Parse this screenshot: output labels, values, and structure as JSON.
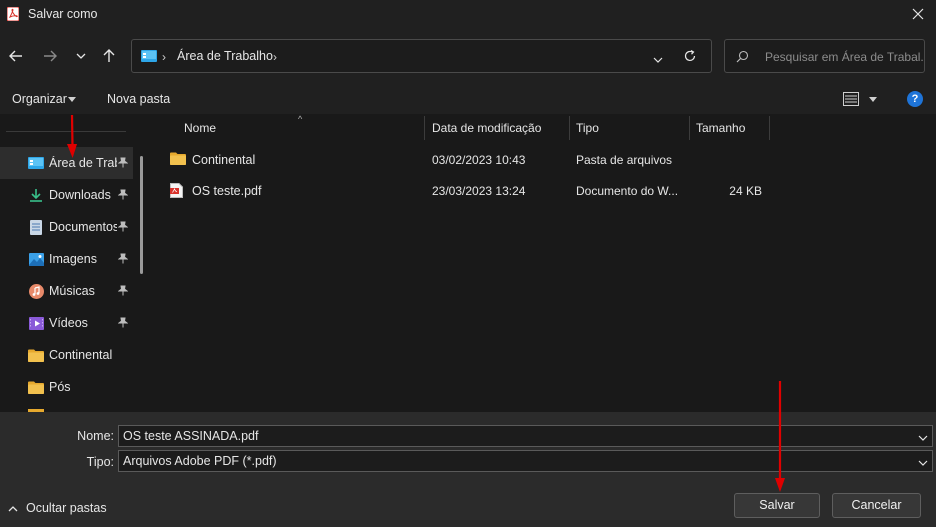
{
  "window": {
    "title": "Salvar como"
  },
  "address_bar": {
    "location": "Área de Trabalho"
  },
  "search": {
    "placeholder": "Pesquisar em Área de Trabal..."
  },
  "command_bar": {
    "organize_label": "Organizar",
    "new_folder_label": "Nova pasta"
  },
  "sidebar": {
    "items": [
      {
        "label": "Área de Trabalho",
        "icon": "desktop-icon",
        "pinned": true,
        "selected": true
      },
      {
        "label": "Downloads",
        "icon": "download-icon",
        "pinned": true
      },
      {
        "label": "Documentos",
        "icon": "document-icon",
        "pinned": true
      },
      {
        "label": "Imagens",
        "icon": "image-icon",
        "pinned": true
      },
      {
        "label": "Músicas",
        "icon": "music-icon",
        "pinned": true
      },
      {
        "label": "Vídeos",
        "icon": "video-icon",
        "pinned": true
      },
      {
        "label": "Continental",
        "icon": "folder-icon",
        "pinned": false
      },
      {
        "label": "Pós",
        "icon": "folder-icon",
        "pinned": false
      }
    ]
  },
  "file_list": {
    "columns": [
      "Nome",
      "Data de modificação",
      "Tipo",
      "Tamanho"
    ],
    "rows": [
      {
        "name": "Continental",
        "date": "03/02/2023 10:43",
        "type": "Pasta de arquivos",
        "size": "",
        "icon": "folder-icon"
      },
      {
        "name": "OS teste.pdf",
        "date": "23/03/2023 13:24",
        "type": "Documento do W...",
        "size": "24 KB",
        "icon": "pdf-file-icon"
      }
    ]
  },
  "save_panel": {
    "name_label": "Nome:",
    "name_value": "OS teste ASSINADA.pdf",
    "type_label": "Tipo:",
    "type_value": "Arquivos Adobe PDF (*.pdf)",
    "hide_folders_label": "Ocultar pastas",
    "save_label": "Salvar",
    "cancel_label": "Cancelar"
  },
  "colors": {
    "accent_blue": "#1e74d8",
    "annotation_red": "#e00000",
    "folder_yellow": "#f2c14e"
  }
}
